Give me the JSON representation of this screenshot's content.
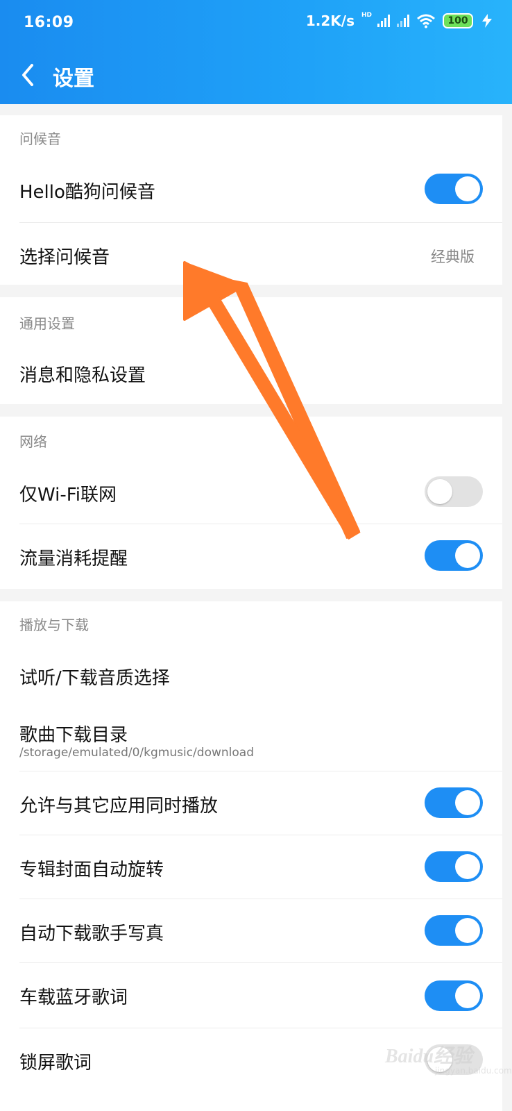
{
  "status_bar": {
    "time": "16:09",
    "speed": "1.2K/s",
    "hd": "HD",
    "battery": "100"
  },
  "header": {
    "title": "设置"
  },
  "sections": {
    "greeting": {
      "title": "问候音",
      "hello_label": "Hello酷狗问候音",
      "hello_on": true,
      "choose_label": "选择问候音",
      "choose_value": "经典版"
    },
    "general": {
      "title": "通用设置",
      "message_label": "消息和隐私设置"
    },
    "network": {
      "title": "网络",
      "wifi_label": "仅Wi-Fi联网",
      "wifi_on": false,
      "data_label": "流量消耗提醒",
      "data_on": true
    },
    "playback": {
      "title": "播放与下载",
      "quality_label": "试听/下载音质选择",
      "dir_label": "歌曲下载目录",
      "dir_value": "/storage/emulated/0/kgmusic/download",
      "mix_label": "允许与其它应用同时播放",
      "mix_on": true,
      "rotate_label": "专辑封面自动旋转",
      "rotate_on": true,
      "photo_label": "自动下载歌手写真",
      "photo_on": true,
      "bt_label": "车载蓝牙歌词",
      "bt_on": true,
      "lock_label": "锁屏歌词",
      "lock_on": false
    }
  },
  "watermark": {
    "brand": "Baidu经验",
    "url": "jingyan.baidu.com"
  },
  "colors": {
    "accent": "#1e8ef4",
    "arrow": "#ff7a2a"
  }
}
